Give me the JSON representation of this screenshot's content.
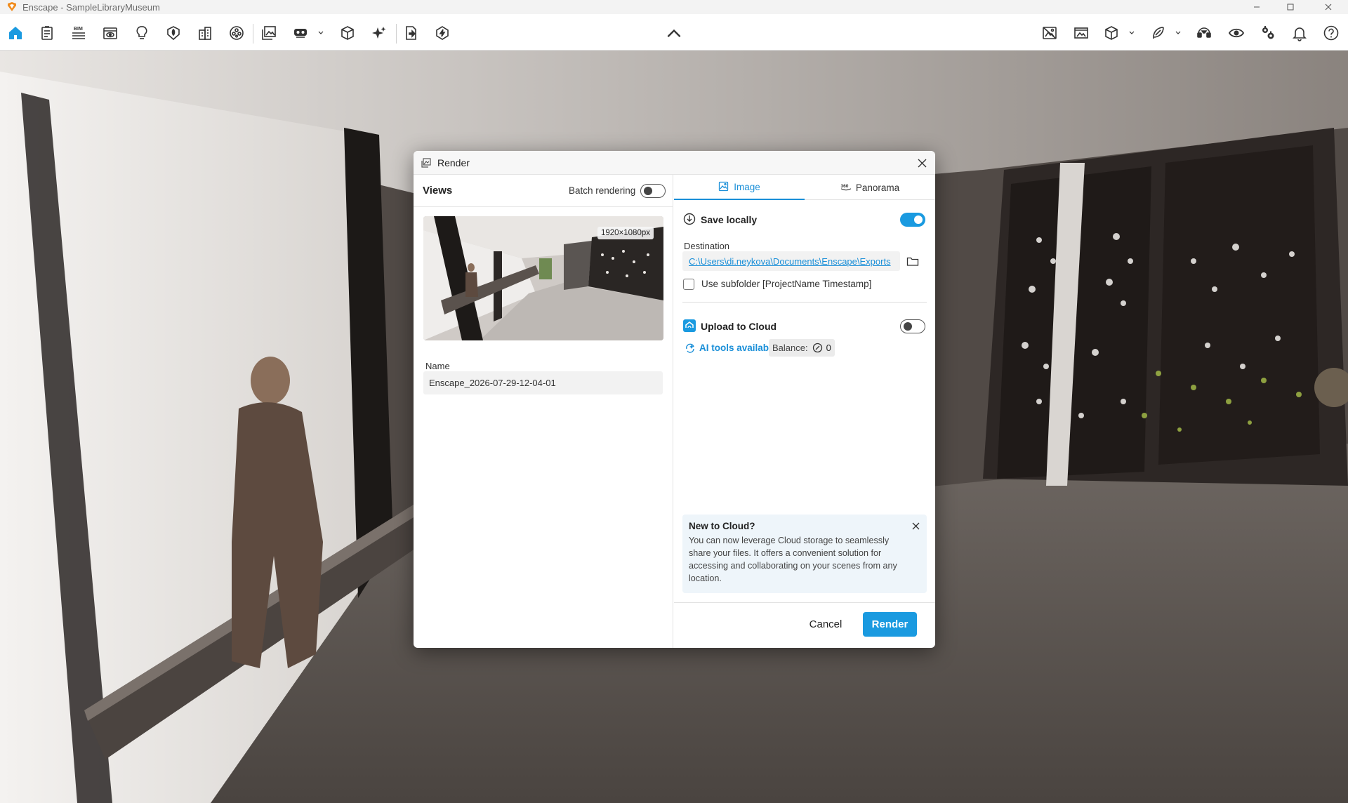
{
  "window": {
    "title": "Enscape - SampleLibraryMuseum"
  },
  "toolbar": {
    "left_icons": [
      "home-icon",
      "documents-icon",
      "bim-icon",
      "views-icon",
      "lightbulb-icon",
      "asset-library-icon",
      "building-icon",
      "material-icon",
      "image-icon",
      "vr-icon",
      "cube-icon",
      "sparkle-icon",
      "export-icon",
      "live-update-icon"
    ],
    "bim_text": "BIM",
    "right_icons": [
      "capture-icon",
      "screenshot-icon",
      "cube-view-icon",
      "feather-icon",
      "headset-icon",
      "eye-icon",
      "settings-icon",
      "bell-icon",
      "help-icon"
    ]
  },
  "dialog": {
    "title": "Render",
    "views": {
      "title": "Views",
      "batch_label": "Batch rendering",
      "batch_enabled": false,
      "resolution": "1920×1080px",
      "name_label": "Name",
      "name_value": "Enscape_2026-07-29-12-04-01"
    },
    "tabs": [
      {
        "label": "Image",
        "active": true
      },
      {
        "label": "Panorama",
        "active": false
      }
    ],
    "panorama_badge": "360",
    "save_locally": {
      "title": "Save locally",
      "enabled": true,
      "destination_label": "Destination",
      "destination_path": "C:\\Users\\di.neykova\\Documents\\Enscape\\Exports",
      "subfolder_label": "Use subfolder [ProjectName Timestamp]",
      "subfolder_checked": false
    },
    "upload_cloud": {
      "title": "Upload to Cloud",
      "enabled": false,
      "ai_link": "AI tools available",
      "balance_label": "Balance:",
      "balance_value": "0"
    },
    "cloud_info": {
      "title": "New to Cloud?",
      "body": "You can now leverage Cloud storage to seamlessly share your files. It offers a convenient solution for accessing and collaborating on your scenes from any location."
    },
    "cancel_label": "Cancel",
    "render_label": "Render"
  },
  "colors": {
    "accent": "#1a9ae0",
    "link": "#1a8fd8",
    "brand_orange": "#f08c1e"
  }
}
